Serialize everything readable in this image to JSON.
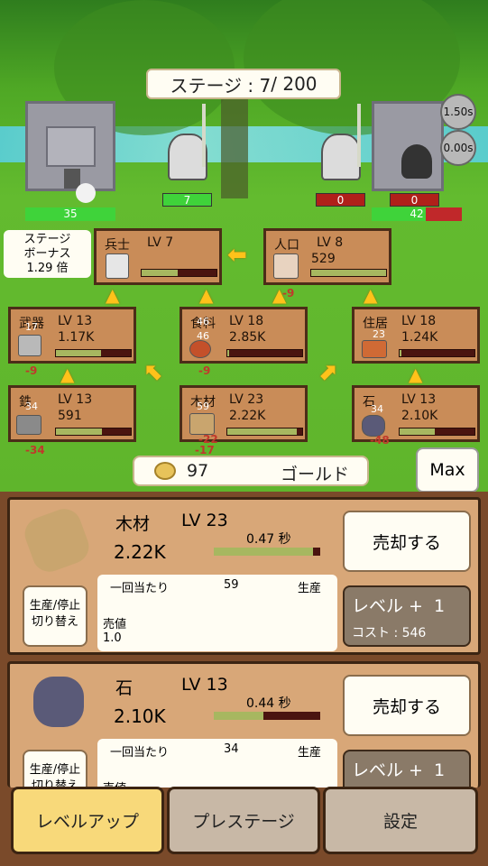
{
  "stage": {
    "label": "ステージ : 7",
    "total": "/ 200"
  },
  "timers": [
    "1.50s",
    "0.00s"
  ],
  "player": {
    "castle_hp": "35",
    "unit_hp": "7"
  },
  "enemy": {
    "unit_hp": "0",
    "unit_hp2": "0",
    "castle_hp": "42"
  },
  "bonus": {
    "line1": "ステージ",
    "line2": "ボーナス",
    "value": "1.29 倍"
  },
  "nodes": {
    "soldier": {
      "name": "兵士",
      "lv": "LV  7"
    },
    "population": {
      "name": "人口",
      "lv": "LV  8",
      "value": "529",
      "delta": "-9"
    },
    "weapon": {
      "name": "武器",
      "lv": "LV  13",
      "value": "1.17K",
      "badge": "17",
      "delta": "-9"
    },
    "food": {
      "name": "食料",
      "lv": "LV  18",
      "value": "2.85K",
      "badge": "46",
      "badge2": "46",
      "delta": "-9"
    },
    "house": {
      "name": "住居",
      "lv": "LV  18",
      "value": "1.24K",
      "badge": "23"
    },
    "iron": {
      "name": "鉄",
      "lv": "LV  13",
      "value": "591",
      "badge": "34",
      "delta": "-34"
    },
    "wood": {
      "name": "木材",
      "lv": "LV  23",
      "value": "2.22K",
      "badge": "59",
      "delta": "-22",
      "delta2": "-17"
    },
    "stone": {
      "name": "石",
      "lv": "LV  13",
      "value": "2.10K",
      "badge": "34",
      "delta": "-48"
    }
  },
  "gold": {
    "amount": "97",
    "label": "ゴールド"
  },
  "max_button": "Max",
  "cards": [
    {
      "name": "木材",
      "lv": "LV  23",
      "amount": "2.22K",
      "time": "0.47 秒",
      "progress": 0.93,
      "sell": "売却する",
      "toggle1": "生産/停止",
      "toggle2": "切り替え",
      "per_label": "一回当たり",
      "per_value": "59",
      "produce": "生産",
      "price_label": "売値",
      "price_value": "1.0",
      "levelup": "レベル +  1",
      "cost": "コスト : 546"
    },
    {
      "name": "石",
      "lv": "LV  13",
      "amount": "2.10K",
      "time": "0.44 秒",
      "progress": 0.47,
      "sell": "売却する",
      "toggle1": "生産/停止",
      "toggle2": "切り替え",
      "per_label": "一回当たり",
      "per_value": "34",
      "produce": "生産",
      "price_label": "売値",
      "levelup": "レベル +  1"
    }
  ],
  "tabs": [
    "レベルアップ",
    "プレステージ",
    "設定"
  ],
  "colors": {
    "tab_active": "#f8d97a",
    "tab_inactive": "#c8b8a6",
    "card": "#d8a778",
    "gold_arrow": "#ffc21a"
  }
}
